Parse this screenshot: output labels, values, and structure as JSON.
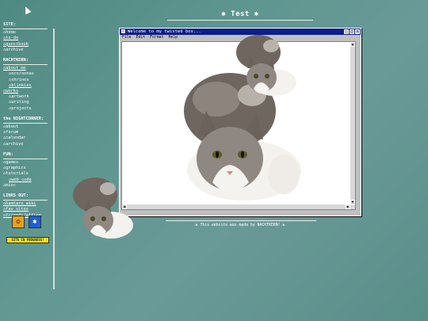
{
  "header": {
    "title": "✱ Test ✱"
  },
  "sidebar": {
    "sections": [
      {
        "heading": "SITE:",
        "items": [
          {
            "label": "⌂home",
            "sub": false,
            "ul": false
          },
          {
            "label": "⌂to-do",
            "sub": false,
            "ul": true
          },
          {
            "label": "⌂guestbook",
            "sub": false,
            "ul": true
          },
          {
            "label": "⌂archive",
            "sub": false,
            "ul": false
          }
        ]
      },
      {
        "heading": "NACHTKERN:",
        "items": [
          {
            "label": "⌂about me",
            "sub": false,
            "ul": true
          },
          {
            "label": "⌂ocs/sonas",
            "sub": true,
            "ul": false
          },
          {
            "label": "⌂shrines",
            "sub": true,
            "ul": false
          },
          {
            "label": "⌂blinkies",
            "sub": true,
            "ul": true
          },
          {
            "label": "⌂works",
            "sub": false,
            "ul": true
          },
          {
            "label": "⌂artwork",
            "sub": true,
            "ul": false
          },
          {
            "label": "⌂writing",
            "sub": true,
            "ul": false
          },
          {
            "label": "⌂projects",
            "sub": true,
            "ul": false
          }
        ]
      },
      {
        "heading": "the NIGHTCORNER:",
        "items": [
          {
            "label": "⌂about",
            "sub": false,
            "ul": false
          },
          {
            "label": "⌂forum",
            "sub": false,
            "ul": false
          },
          {
            "label": "⌂calendar",
            "sub": false,
            "ul": false
          },
          {
            "label": "⌂archive",
            "sub": false,
            "ul": false
          }
        ]
      },
      {
        "heading": "FUN:",
        "items": [
          {
            "label": "⌂games",
            "sub": false,
            "ul": false
          },
          {
            "label": "⌂graphics",
            "sub": false,
            "ul": false
          },
          {
            "label": "⌂tutorials",
            "sub": false,
            "ul": false
          },
          {
            "label": "⌂web code",
            "sub": true,
            "ul": true
          },
          {
            "label": "⌂misc",
            "sub": false,
            "ul": false
          }
        ]
      },
      {
        "heading": "LINKS OUT:",
        "items": [
          {
            "label": "⌂hamtaro wiki",
            "sub": false,
            "ul": true
          },
          {
            "label": "⌂fav sites",
            "sub": false,
            "ul": true
          },
          {
            "label": "⌂friends/affies",
            "sub": false,
            "ul": true
          }
        ]
      }
    ],
    "badge_text": "SITE IN PROGRESS!"
  },
  "window": {
    "title": "Welcome to my twisted box...",
    "menu": [
      "File",
      "Edit",
      "Format",
      "Help"
    ]
  },
  "footer": {
    "text": "✱ This website was made by NACHTKERN! ✱"
  },
  "colors": {
    "background": "#5f9690",
    "titlebar": "#0a1e8c",
    "badge": "#f0e018"
  }
}
